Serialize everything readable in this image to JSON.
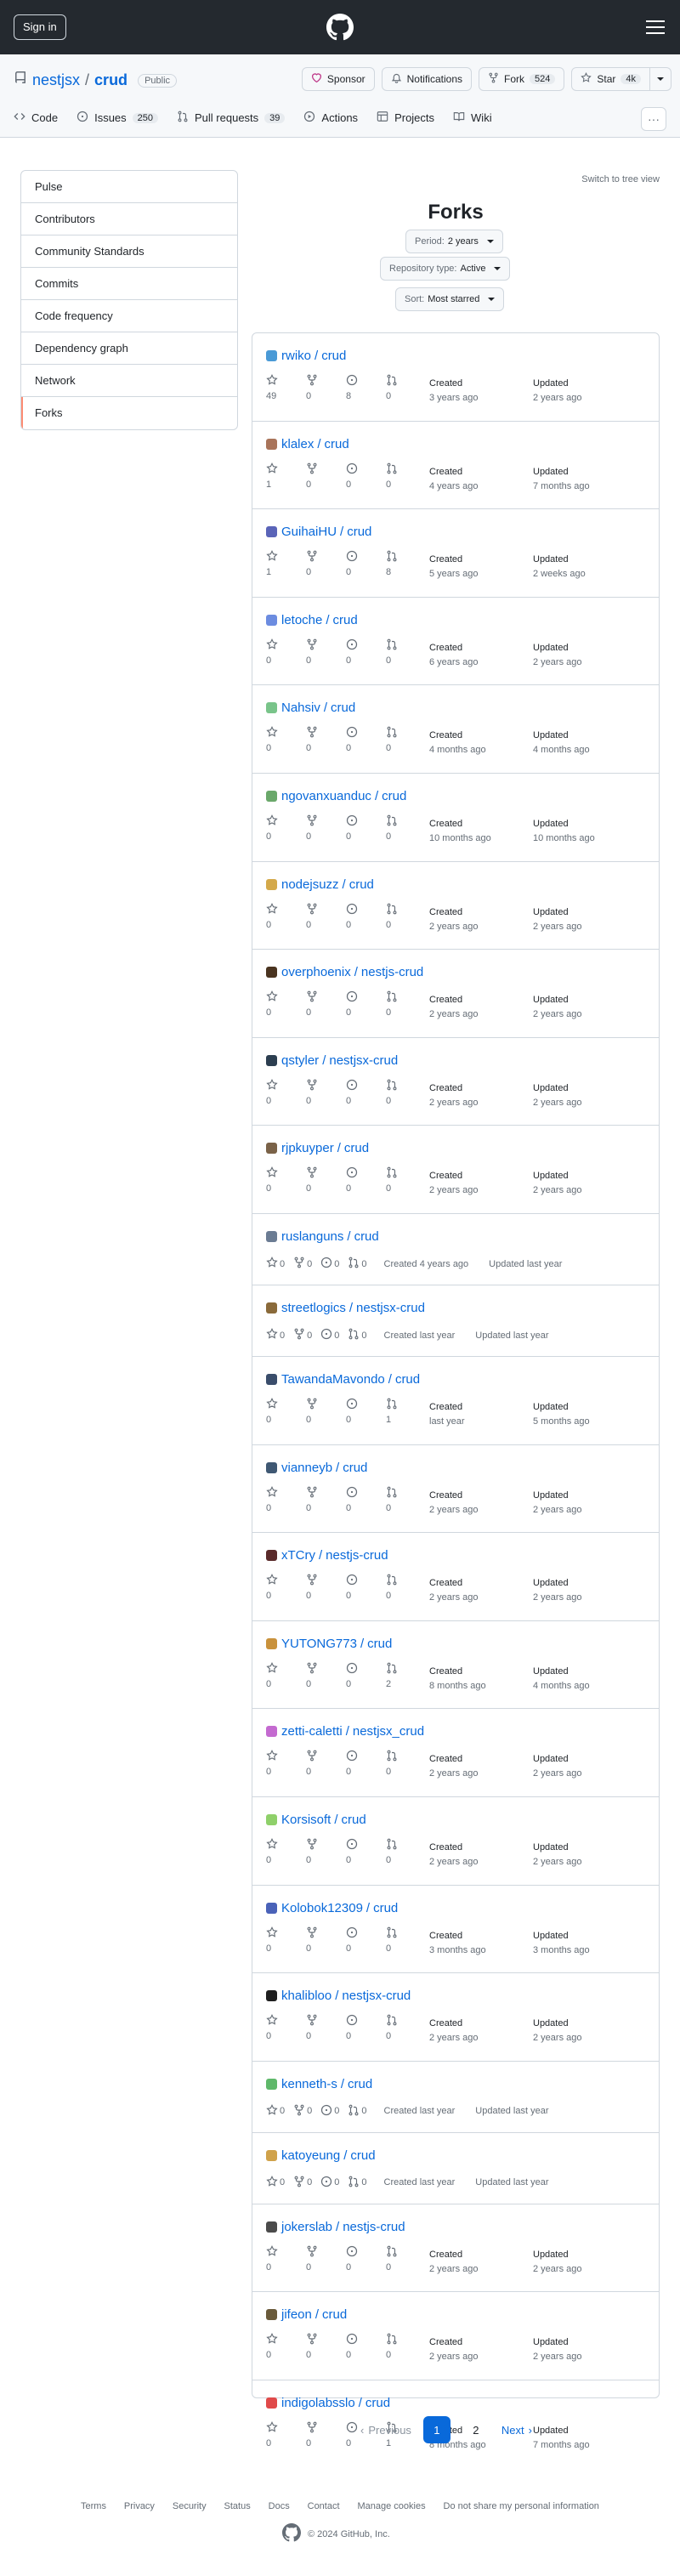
{
  "header": {
    "sign_in": "Sign in"
  },
  "repo": {
    "owner": "nestjsx",
    "separator": "/",
    "name": "crud",
    "visibility": "Public",
    "actions": {
      "sponsor": "Sponsor",
      "notifications": "Notifications",
      "fork": "Fork",
      "fork_count": "524",
      "star": "Star",
      "star_count": "4k"
    }
  },
  "tabs": [
    {
      "label": "Code",
      "count": "",
      "icon": "code-icon"
    },
    {
      "label": "Issues",
      "count": "250",
      "icon": "issue-icon"
    },
    {
      "label": "Pull requests",
      "count": "39",
      "icon": "pull-request-icon"
    },
    {
      "label": "Actions",
      "count": "",
      "icon": "play-icon"
    },
    {
      "label": "Projects",
      "count": "",
      "icon": "table-icon"
    },
    {
      "label": "Wiki",
      "count": "",
      "icon": "book-icon"
    }
  ],
  "sidebar": {
    "items": [
      {
        "label": "Pulse"
      },
      {
        "label": "Contributors"
      },
      {
        "label": "Community Standards"
      },
      {
        "label": "Commits"
      },
      {
        "label": "Code frequency"
      },
      {
        "label": "Dependency graph"
      },
      {
        "label": "Network"
      },
      {
        "label": "Forks"
      }
    ],
    "active": "Forks"
  },
  "main": {
    "switch_view": "Switch to tree view",
    "title": "Forks",
    "filters": {
      "period": {
        "label": "Period:",
        "value": "2 years"
      },
      "repo_type": {
        "label": "Repository type:",
        "value": "Active"
      },
      "sort": {
        "label": "Sort:",
        "value": "Most starred"
      }
    }
  },
  "forks": [
    {
      "owner": "rwiko",
      "repo": "crud",
      "stars": "49",
      "forks": "0",
      "issues": "8",
      "prs": "0",
      "created": "3 years ago",
      "updated": "2 years ago",
      "color": "#4a9ad6"
    },
    {
      "owner": "klalex",
      "repo": "crud",
      "stars": "1",
      "forks": "0",
      "issues": "0",
      "prs": "0",
      "created": "4 years ago",
      "updated": "7 months ago",
      "color": "#a9745a"
    },
    {
      "owner": "GuihaiHU",
      "repo": "crud",
      "stars": "1",
      "forks": "0",
      "issues": "0",
      "prs": "8",
      "created": "5 years ago",
      "updated": "2 weeks ago",
      "color": "#5a64b8"
    },
    {
      "owner": "letoche",
      "repo": "crud",
      "stars": "0",
      "forks": "0",
      "issues": "0",
      "prs": "0",
      "created": "6 years ago",
      "updated": "2 years ago",
      "color": "#6c8ce0"
    },
    {
      "owner": "Nahsiv",
      "repo": "crud",
      "stars": "0",
      "forks": "0",
      "issues": "0",
      "prs": "0",
      "created": "4 months ago",
      "updated": "4 months ago",
      "color": "#79c48a"
    },
    {
      "owner": "ngovanxuanduc",
      "repo": "crud",
      "stars": "0",
      "forks": "0",
      "issues": "0",
      "prs": "0",
      "created": "10 months ago",
      "updated": "10 months ago",
      "color": "#6aa86a"
    },
    {
      "owner": "nodejsuzz",
      "repo": "crud",
      "stars": "0",
      "forks": "0",
      "issues": "0",
      "prs": "0",
      "created": "2 years ago",
      "updated": "2 years ago",
      "color": "#d4a94a"
    },
    {
      "owner": "overphoenix",
      "repo": "nestjs-crud",
      "stars": "0",
      "forks": "0",
      "issues": "0",
      "prs": "0",
      "created": "2 years ago",
      "updated": "2 years ago",
      "color": "#4a3420"
    },
    {
      "owner": "qstyler",
      "repo": "nestjsx-crud",
      "stars": "0",
      "forks": "0",
      "issues": "0",
      "prs": "0",
      "created": "2 years ago",
      "updated": "2 years ago",
      "color": "#2c3e50"
    },
    {
      "owner": "rjpkuyper",
      "repo": "crud",
      "stars": "0",
      "forks": "0",
      "issues": "0",
      "prs": "0",
      "created": "2 years ago",
      "updated": "2 years ago",
      "color": "#7a6248"
    },
    {
      "owner": "ruslanguns",
      "repo": "crud",
      "stars": "0",
      "forks": "0",
      "issues": "0",
      "prs": "0",
      "created": "Created 4 years ago",
      "updated": "Updated last year",
      "color": "#6b7c93",
      "inline": true
    },
    {
      "owner": "streetlogics",
      "repo": "nestjsx-crud",
      "stars": "0",
      "forks": "0",
      "issues": "0",
      "prs": "0",
      "created": "Created last year",
      "updated": "Updated last year",
      "color": "#8a6a3a",
      "inline": true
    },
    {
      "owner": "TawandaMavondo",
      "repo": "crud",
      "stars": "0",
      "forks": "0",
      "issues": "0",
      "prs": "1",
      "created": "last year",
      "updated": "5 months ago",
      "color": "#3a4d6b"
    },
    {
      "owner": "vianneyb",
      "repo": "crud",
      "stars": "0",
      "forks": "0",
      "issues": "0",
      "prs": "0",
      "created": "2 years ago",
      "updated": "2 years ago",
      "color": "#3f5873"
    },
    {
      "owner": "xTCry",
      "repo": "nestjs-crud",
      "stars": "0",
      "forks": "0",
      "issues": "0",
      "prs": "0",
      "created": "2 years ago",
      "updated": "2 years ago",
      "color": "#5a2a2a"
    },
    {
      "owner": "YUTONG773",
      "repo": "crud",
      "stars": "0",
      "forks": "0",
      "issues": "0",
      "prs": "2",
      "created": "8 months ago",
      "updated": "4 months ago",
      "color": "#c9923c"
    },
    {
      "owner": "zetti-caletti",
      "repo": "nestjsx_crud",
      "stars": "0",
      "forks": "0",
      "issues": "0",
      "prs": "0",
      "created": "2 years ago",
      "updated": "2 years ago",
      "color": "#c46ad0"
    },
    {
      "owner": "Korsisoft",
      "repo": "crud",
      "stars": "0",
      "forks": "0",
      "issues": "0",
      "prs": "0",
      "created": "2 years ago",
      "updated": "2 years ago",
      "color": "#8fd06a"
    },
    {
      "owner": "Kolobok12309",
      "repo": "crud",
      "stars": "0",
      "forks": "0",
      "issues": "0",
      "prs": "0",
      "created": "3 months ago",
      "updated": "3 months ago",
      "color": "#4a62b8"
    },
    {
      "owner": "khalibloo",
      "repo": "nestjsx-crud",
      "stars": "0",
      "forks": "0",
      "issues": "0",
      "prs": "0",
      "created": "2 years ago",
      "updated": "2 years ago",
      "color": "#1f1f1f"
    },
    {
      "owner": "kenneth-s",
      "repo": "crud",
      "stars": "0",
      "forks": "0",
      "issues": "0",
      "prs": "0",
      "created": "Created last year",
      "updated": "Updated last year",
      "color": "#5fb86a",
      "inline": true
    },
    {
      "owner": "katoyeung",
      "repo": "crud",
      "stars": "0",
      "forks": "0",
      "issues": "0",
      "prs": "0",
      "created": "Created last year",
      "updated": "Updated last year",
      "color": "#d0a24a",
      "inline": true
    },
    {
      "owner": "jokerslab",
      "repo": "nestjs-crud",
      "stars": "0",
      "forks": "0",
      "issues": "0",
      "prs": "0",
      "created": "2 years ago",
      "updated": "2 years ago",
      "color": "#4b4b4b"
    },
    {
      "owner": "jifeon",
      "repo": "crud",
      "stars": "0",
      "forks": "0",
      "issues": "0",
      "prs": "0",
      "created": "2 years ago",
      "updated": "2 years ago",
      "color": "#6a5a3a"
    },
    {
      "owner": "indigolabsslo",
      "repo": "crud",
      "stars": "0",
      "forks": "0",
      "issues": "0",
      "prs": "1",
      "created": "8 months ago",
      "updated": "7 months ago",
      "color": "#e04a4a"
    }
  ],
  "labels": {
    "created": "Created",
    "updated": "Updated"
  },
  "pagination": {
    "previous": "Previous",
    "pages": [
      "1",
      "2"
    ],
    "current": "1",
    "next": "Next"
  },
  "footer": {
    "links": [
      "Terms",
      "Privacy",
      "Security",
      "Status",
      "Docs",
      "Contact",
      "Manage cookies",
      "Do not share my personal information"
    ],
    "copyright": "© 2024 GitHub, Inc."
  }
}
